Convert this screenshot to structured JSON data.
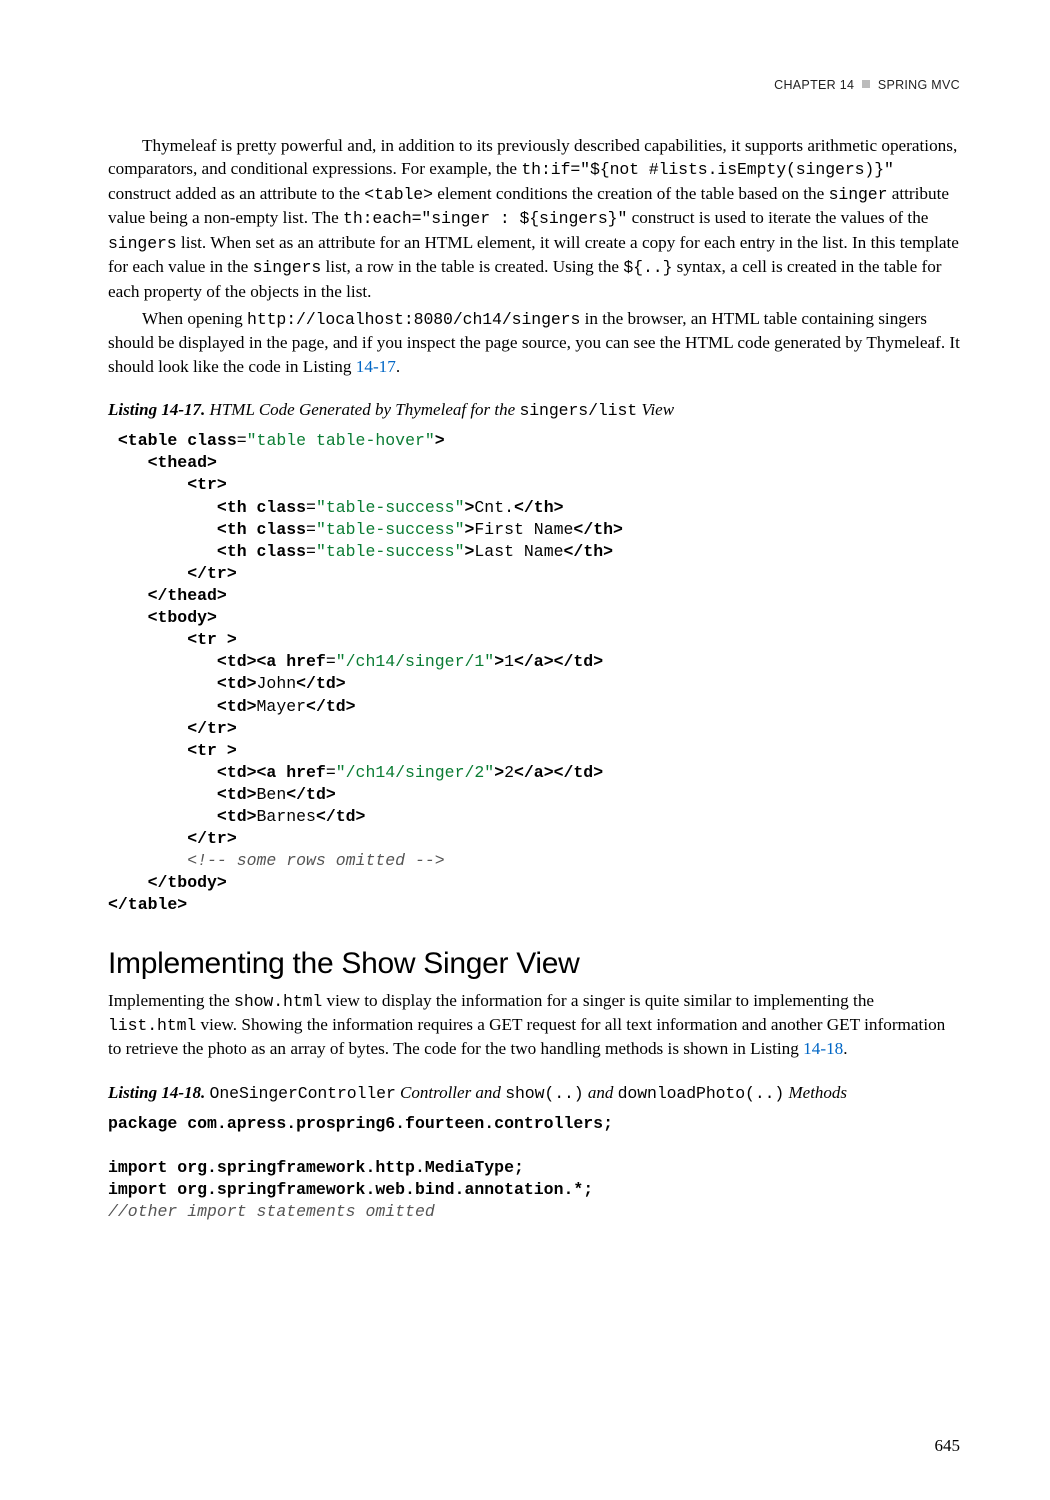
{
  "runningHead": {
    "chapter": "CHAPTER 14",
    "title": "SPRING MVC"
  },
  "para1_a": "Thymeleaf is pretty powerful and, in addition to its previously described capabilities, it supports arithmetic operations, comparators, and conditional expressions. For example, the ",
  "para1_code1": "th:if=\"${not #lists.isEmpty(singers)}\"",
  "para1_b": " construct added as an attribute to the ",
  "para1_code2": "<table>",
  "para1_c": " element conditions the creation of the table based on the ",
  "para1_code3": "singer",
  "para1_d": " attribute value being a non-empty list. The ",
  "para1_code4": "th:each=\"singer : ${singers}\"",
  "para1_e": " construct is used to iterate the values of the ",
  "para1_code5": "singers",
  "para1_f": " list. When set as an attribute for an HTML element, it will create a copy for each entry in the list. In this template for each value in the ",
  "para1_code6": "singers",
  "para1_g": " list, a row in the table is created. Using the ",
  "para1_code7": "${..}",
  "para1_h": " syntax, a cell is created in the table for each property of the objects in the list.",
  "para2_a": "When opening ",
  "para2_code1": "http://localhost:8080/ch14/singers",
  "para2_b": " in the browser, an HTML table containing singers should be displayed in the page, and if you inspect the page source, you can see the HTML code generated by Thymeleaf. It should look like the code in Listing ",
  "para2_link": "14-17",
  "para2_c": ".",
  "listing17": {
    "label": "Listing 14-17.",
    "title_a": "  HTML Code Generated by Thymeleaf for the ",
    "title_code": "singers/list",
    "title_b": " View"
  },
  "code17": {
    "l01a": " <table class",
    "l01b": "=",
    "l01c": "\"table table-hover\"",
    "l01d": ">",
    "l02": "    <thead>",
    "l03": "        <tr>",
    "l04a": "           <th class",
    "l04b": "=",
    "l04c": "\"table-success\"",
    "l04d": ">",
    "l04e": "Cnt.",
    "l04f": "</th>",
    "l05a": "           <th class",
    "l05b": "=",
    "l05c": "\"table-success\"",
    "l05d": ">",
    "l05e": "First Name",
    "l05f": "</th>",
    "l06a": "           <th class",
    "l06b": "=",
    "l06c": "\"table-success\"",
    "l06d": ">",
    "l06e": "Last Name",
    "l06f": "</th>",
    "l07": "        </tr>",
    "l08": "    </thead>",
    "l09": "    <tbody>",
    "l10": "        <tr >",
    "l11a": "           <td><a href",
    "l11b": "=",
    "l11c": "\"/ch14/singer/1\"",
    "l11d": ">",
    "l11e": "1",
    "l11f": "</a></td>",
    "l12a": "           <td>",
    "l12b": "John",
    "l12c": "</td>",
    "l13a": "           <td>",
    "l13b": "Mayer",
    "l13c": "</td>",
    "l14": "        </tr>",
    "l15": "        <tr >",
    "l16a": "           <td><a href",
    "l16b": "=",
    "l16c": "\"/ch14/singer/2\"",
    "l16d": ">",
    "l16e": "2",
    "l16f": "</a></td>",
    "l17a": "           <td>",
    "l17b": "Ben",
    "l17c": "</td>",
    "l18a": "           <td>",
    "l18b": "Barnes",
    "l18c": "</td>",
    "l19": "        </tr>",
    "l20": "        <!-- some rows omitted -->",
    "l21": "    </tbody>",
    "l22": "</table>"
  },
  "sectionTitle": "Implementing the Show Singer View",
  "para3_a": "Implementing the ",
  "para3_code1": "show.html",
  "para3_b": " view to display the information for a singer is quite similar to implementing the ",
  "para3_code2": "list.html",
  "para3_c": " view. Showing the information requires a GET request for all text information and another GET information to retrieve the photo as an array of bytes. The code for the two handling methods is shown in Listing ",
  "para3_link": "14-18",
  "para3_d": ".",
  "listing18": {
    "label": "Listing 14-18.",
    "title_a": "  ",
    "title_code1": "OneSingerController",
    "title_b": " Controller and ",
    "title_code2": "show(..)",
    "title_c": " and ",
    "title_code3": "downloadPhoto(..)",
    "title_d": " Methods"
  },
  "code18": {
    "l01": "package com.apress.prospring6.fourteen.controllers;",
    "l02": "",
    "l03": "import org.springframework.http.MediaType;",
    "l04": "import org.springframework.web.bind.annotation.*;",
    "l05": "//other import statements omitted"
  },
  "pageNumber": "645"
}
